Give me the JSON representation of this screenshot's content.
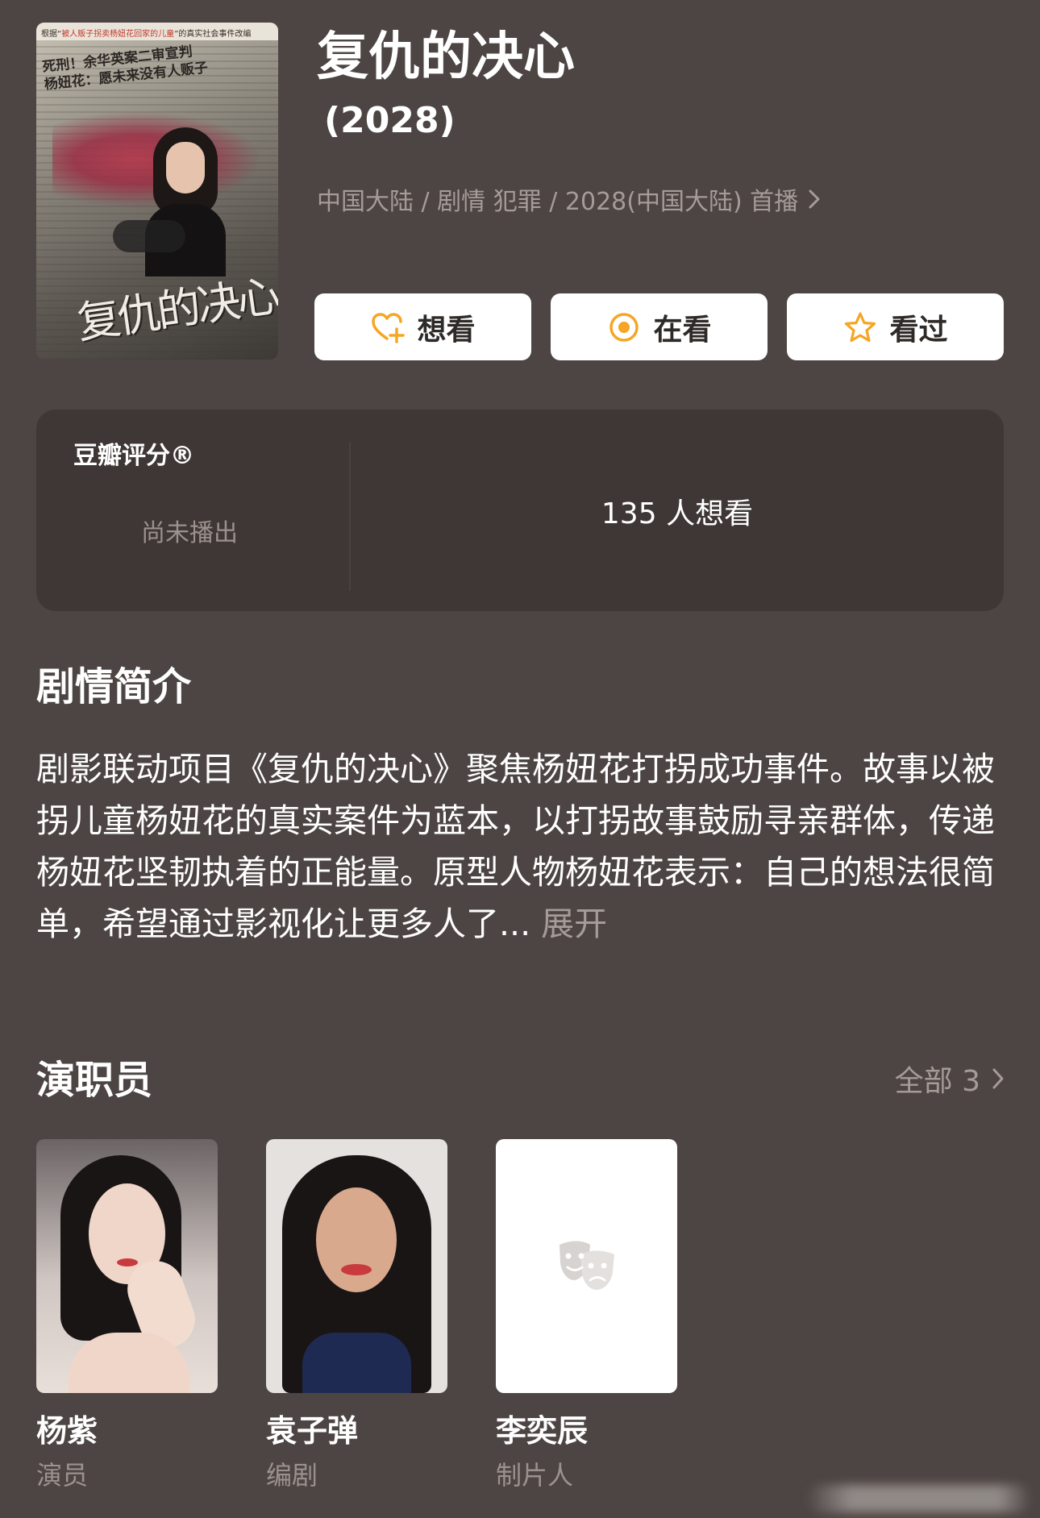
{
  "show": {
    "title": "复仇的决心",
    "year": "(2028)",
    "meta": "中国大陆 / 剧情 犯罪 / 2028(中国大陆) 首播"
  },
  "poster": {
    "strip_prefix": "根据“",
    "strip_red": "被人贩子拐卖杨妞花回家的儿童",
    "strip_suffix": "”的真实社会事件改编",
    "headline": "死刑！余华英案二审宣判\n杨妞花：愿未来没有人贩子",
    "calligraphy": "复仇的决心"
  },
  "actions": [
    {
      "label": "想看",
      "icon": "heart-plus-icon"
    },
    {
      "label": "在看",
      "icon": "target-icon"
    },
    {
      "label": "看过",
      "icon": "star-icon"
    }
  ],
  "rating": {
    "label": "豆瓣评分®",
    "status": "尚未播出",
    "wish_count": "135 人想看"
  },
  "synopsis": {
    "heading": "剧情简介",
    "text": "剧影联动项目《复仇的决心》聚焦杨妞花打拐成功事件。故事以被拐儿童杨妞花的真实案件为蓝本，以打拐故事鼓励寻亲群体，传递杨妞花坚韧执着的正能量。原型人物杨妞花表示：自己的想法很简单，希望通过影视化让更多人了...",
    "more": "展开"
  },
  "cast": {
    "heading": "演职员",
    "all_label": "全部 3",
    "members": [
      {
        "name": "杨紫",
        "role": "演员"
      },
      {
        "name": "袁子弹",
        "role": "编剧"
      },
      {
        "name": "李奕辰",
        "role": "制片人"
      }
    ]
  },
  "colors": {
    "background": "#4d4543",
    "card": "#3e3735",
    "accent": "#f5a623",
    "muted_text": "#a59c98"
  }
}
